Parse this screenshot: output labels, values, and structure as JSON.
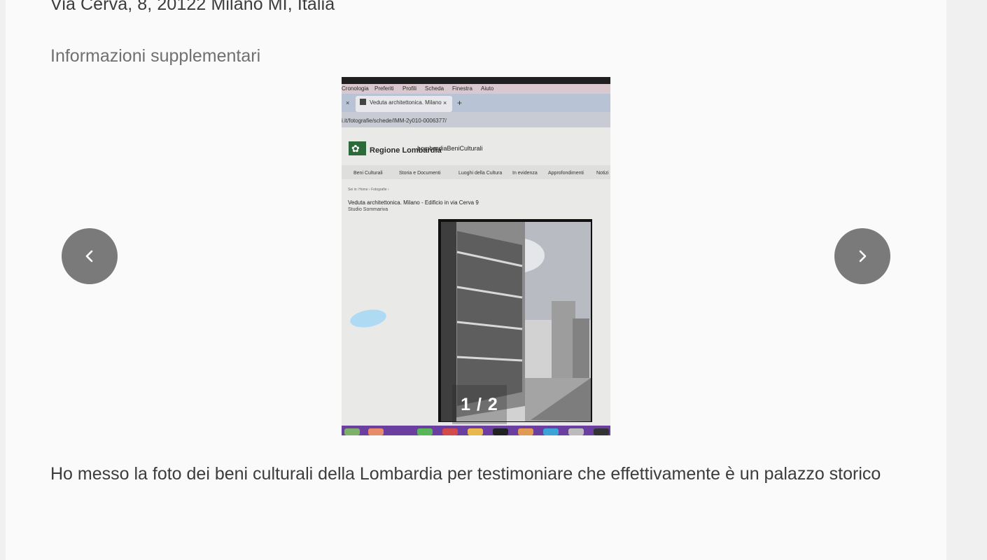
{
  "address": "Via Cerva, 8, 20122 Milano MI, Italia",
  "section_title": "Informazioni supplementari",
  "gallery": {
    "counter": "1 / 2",
    "prev_icon": "chevron-left-icon",
    "next_icon": "chevron-right-icon",
    "photo": {
      "menu_items": [
        "Cronologia",
        "Preferiti",
        "Profili",
        "Scheda",
        "Finestra",
        "Aiuto"
      ],
      "tab_title": "Veduta architettonica. Milano",
      "url": "i.it/fotografie/schede/IMM-2y010-0006377/",
      "site_logo": "Regione Lombardia",
      "site_name": "LombardiaBeniCulturali",
      "nav_items": [
        "Beni Culturali",
        "Storia e Documenti",
        "Luoghi della Cultura",
        "In evidenza",
        "Approfondimenti",
        "Notizi"
      ],
      "breadcrumb": "Sei in: Home › Fotografie ›",
      "heading": "Veduta architettonica. Milano - Edificio in via Cerva 9",
      "author": "Studio Sommariva"
    }
  },
  "description": "Ho messo la foto dei beni culturali della Lombardia per testimoniare che effettivamente è un palazzo storico"
}
